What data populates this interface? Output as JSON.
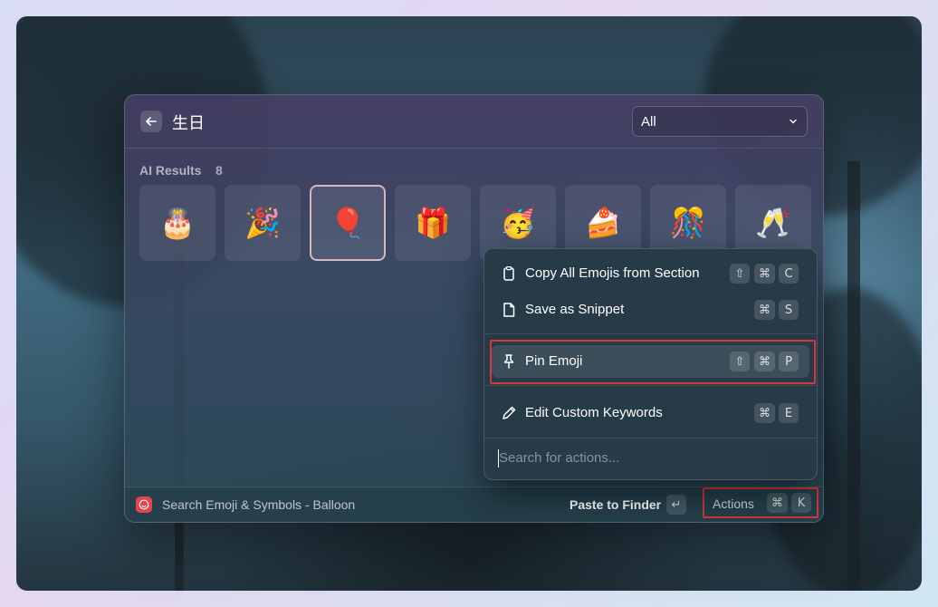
{
  "search": {
    "query": "生日"
  },
  "filter": {
    "selected": "All"
  },
  "section": {
    "title": "AI Results",
    "count": "8"
  },
  "emojis": [
    "🎂",
    "🎉",
    "🎈",
    "🎁",
    "🥳",
    "🍰",
    "🎊",
    "🥂"
  ],
  "selected_index": 2,
  "menu": {
    "items": [
      {
        "label": "Copy All Emojis from Section",
        "icon": "clipboard-icon",
        "keys": [
          "⇧",
          "⌘",
          "C"
        ]
      },
      {
        "label": "Save as Snippet",
        "icon": "document-icon",
        "keys": [
          "⌘",
          "S"
        ]
      },
      {
        "label": "Pin Emoji",
        "icon": "pin-icon",
        "keys": [
          "⇧",
          "⌘",
          "P"
        ]
      },
      {
        "label": "Edit Custom Keywords",
        "icon": "pencil-icon",
        "keys": [
          "⌘",
          "E"
        ]
      }
    ],
    "search_placeholder": "Search for actions..."
  },
  "footer": {
    "title": "Search Emoji & Symbols - Balloon",
    "primary_action": "Paste to Finder",
    "enter_key": "↵",
    "actions_label": "Actions",
    "actions_keys": [
      "⌘",
      "K"
    ]
  },
  "colors": {
    "highlight": "#d8363a",
    "extension_icon": "#e8444f"
  }
}
